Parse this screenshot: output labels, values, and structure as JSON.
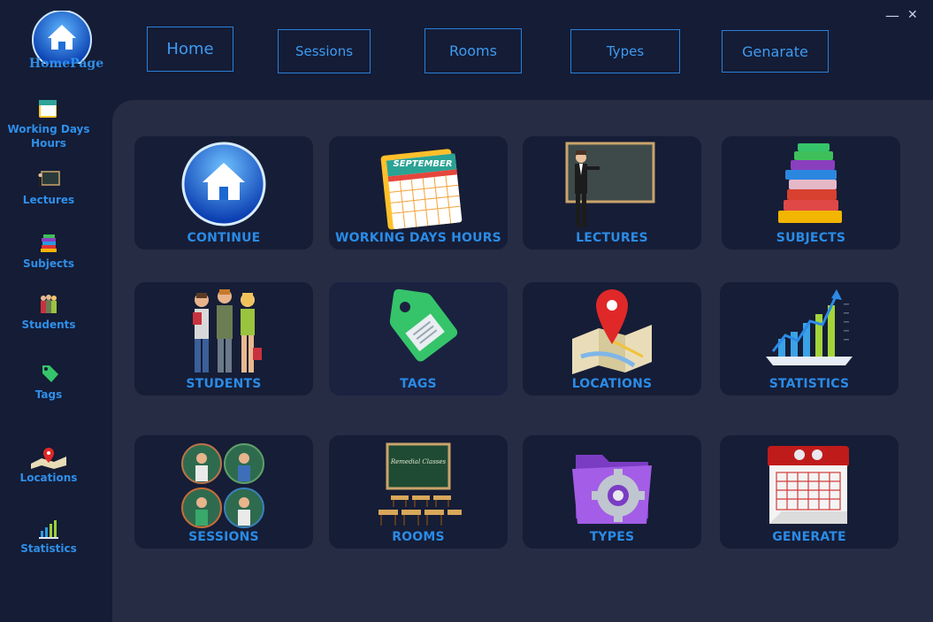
{
  "window": {
    "minimize": "—",
    "close": "✕"
  },
  "logo": {
    "label": "HomePage"
  },
  "nav": [
    {
      "label": "Home"
    },
    {
      "label": "Sessions"
    },
    {
      "label": "Rooms"
    },
    {
      "label": "Types"
    },
    {
      "label": "Genarate"
    }
  ],
  "sidebar": {
    "working_days_line1": "Working Days",
    "working_days_line2": "Hours",
    "lectures": "Lectures",
    "subjects": "Subjects",
    "students": "Students",
    "tags": "Tags",
    "locations": "Locations",
    "statistics": "Statistics"
  },
  "tiles": {
    "continue": "CONTINUE",
    "working_days": "WORKING DAYS  HOURS",
    "lectures": "LECTURES",
    "subjects": "SUBJECTS",
    "students": "STUDENTS",
    "tags": "TAGS",
    "locations": "LOCATIONS",
    "statistics": "STATISTICS",
    "sessions": "SESSIONS",
    "rooms": "ROOMS",
    "types": "TYPES",
    "generate": "GENERATE"
  },
  "calendar_month": "SEPTEMBER",
  "board_text": "Remedial Classes",
  "colors": {
    "accent": "#2a8be6",
    "background": "#141c36",
    "panel": "#252c44",
    "tile": "#161d36"
  }
}
